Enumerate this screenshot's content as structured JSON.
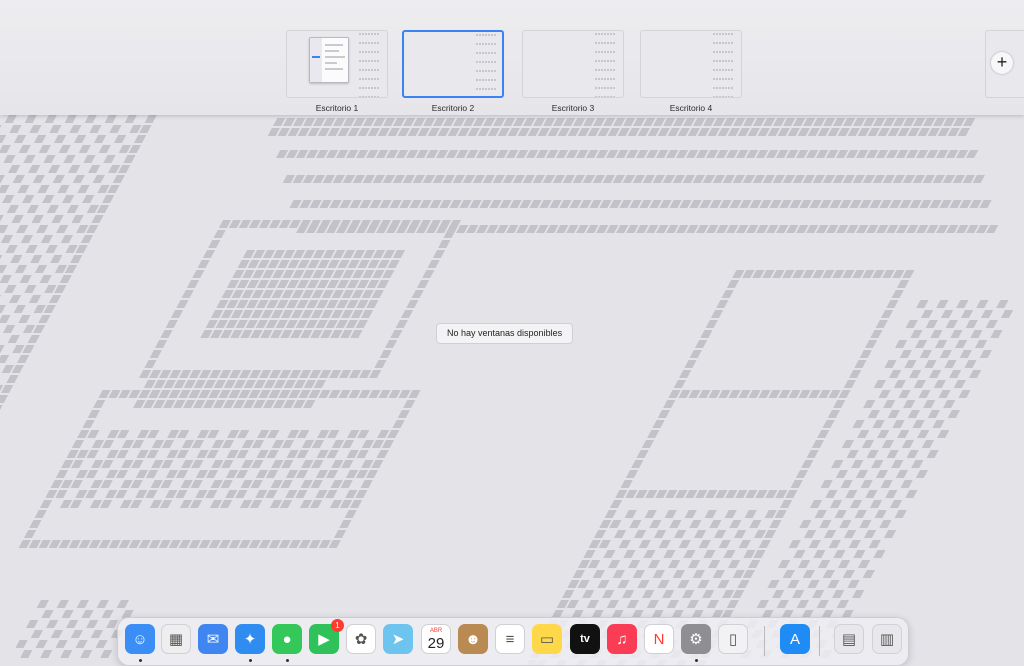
{
  "spaces": [
    {
      "label": "Escritorio 1",
      "selected": false,
      "has_window": true
    },
    {
      "label": "Escritorio 2",
      "selected": true,
      "has_window": false
    },
    {
      "label": "Escritorio 3",
      "selected": false,
      "has_window": false
    },
    {
      "label": "Escritorio 4",
      "selected": false,
      "has_window": false
    }
  ],
  "add_space_icon": "plus-icon",
  "add_space_glyph": "+",
  "no_windows_text": "No hay ventanas disponibles",
  "dock": {
    "apps": [
      {
        "name": "finder",
        "icon": "finder-icon",
        "running": true,
        "color": "#3a8ef6"
      },
      {
        "name": "launchpad",
        "icon": "launchpad-icon",
        "running": false,
        "color": "#eeeeee"
      },
      {
        "name": "mail",
        "icon": "mail-icon",
        "running": false,
        "color": "#3f86f0"
      },
      {
        "name": "safari",
        "icon": "safari-icon",
        "running": true,
        "color": "#2f8cf0"
      },
      {
        "name": "messages",
        "icon": "messages-icon",
        "running": true,
        "color": "#34c759"
      },
      {
        "name": "facetime",
        "icon": "facetime-icon",
        "running": false,
        "color": "#30c25a",
        "badge": "1"
      },
      {
        "name": "photos",
        "icon": "photos-icon",
        "running": false,
        "color": "#ffffff"
      },
      {
        "name": "maps",
        "icon": "maps-icon",
        "running": false,
        "color": "#6cc4ef"
      },
      {
        "name": "calendar",
        "icon": "calendar-icon",
        "running": false,
        "color": "#ffffff",
        "month": "ABR",
        "day": "29"
      },
      {
        "name": "contacts",
        "icon": "contacts-icon",
        "running": false,
        "color": "#b98a51"
      },
      {
        "name": "reminders",
        "icon": "reminders-icon",
        "running": false,
        "color": "#ffffff"
      },
      {
        "name": "notes",
        "icon": "notes-icon",
        "running": false,
        "color": "#ffd84a"
      },
      {
        "name": "tv",
        "icon": "tv-icon",
        "running": false,
        "color": "#111111",
        "text": "tv"
      },
      {
        "name": "music",
        "icon": "music-icon",
        "running": false,
        "color": "#fa3c55"
      },
      {
        "name": "news",
        "icon": "news-icon",
        "running": false,
        "color": "#ffffff"
      },
      {
        "name": "system-preferences",
        "icon": "gear-icon",
        "running": true,
        "color": "#8e8e93"
      },
      {
        "name": "iphone-mirroring",
        "icon": "phone-icon",
        "running": false,
        "color": "#f2f2f4"
      },
      {
        "name": "app-store",
        "icon": "app-store-icon",
        "running": false,
        "color": "#1f8cf5"
      },
      {
        "name": "downloads",
        "icon": "document-icon",
        "running": false,
        "color": "#e8e8ec"
      },
      {
        "name": "trash",
        "icon": "trash-icon",
        "running": false,
        "color": "#e8e8ec"
      }
    ]
  }
}
